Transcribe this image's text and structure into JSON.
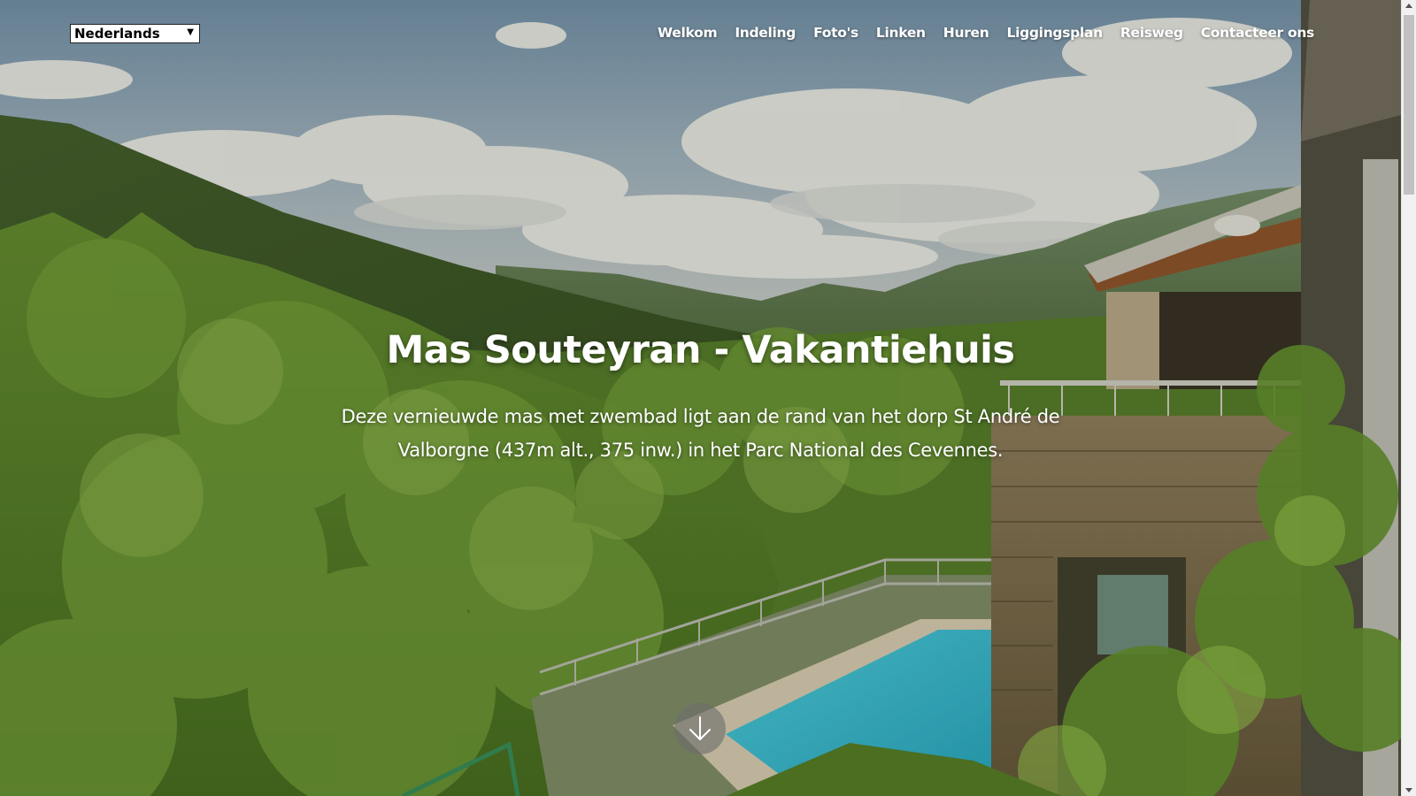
{
  "language_select": {
    "selected": "Nederlands"
  },
  "nav": {
    "items": [
      {
        "label": "Welkom"
      },
      {
        "label": "Indeling"
      },
      {
        "label": "Foto's"
      },
      {
        "label": "Linken"
      },
      {
        "label": "Huren"
      },
      {
        "label": "Liggingsplan"
      },
      {
        "label": "Reisweg"
      },
      {
        "label": "Contacteer ons"
      }
    ]
  },
  "hero": {
    "title": "Mas Souteyran - Vakantiehuis",
    "description": "Deze vernieuwde mas met zwembad ligt aan de rand van het dorp St André de Valborgne (437m alt., 375 inw.) in het Parc National des Cevennes.",
    "scroll_icon": "arrow-down-icon"
  },
  "colors": {
    "text": "#ffffff",
    "pool": "#35c3dd",
    "scroll_button": "#6e6e6e"
  }
}
